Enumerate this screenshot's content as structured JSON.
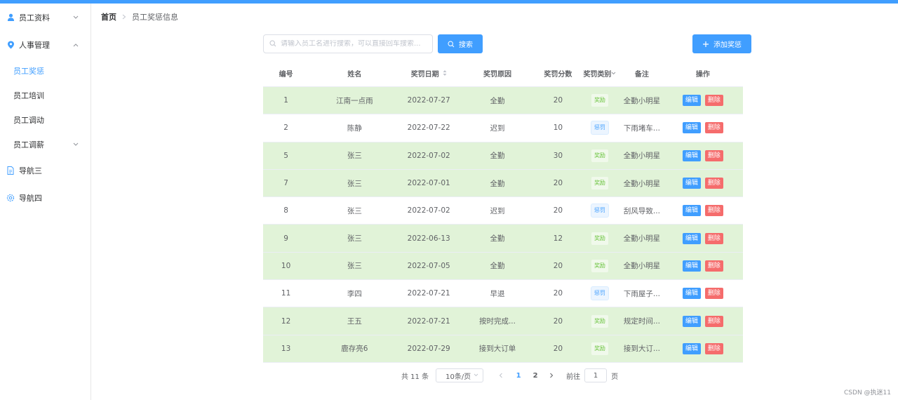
{
  "colors": {
    "primary": "#409eff",
    "success": "#67c23a",
    "danger": "#f56c6c",
    "row_highlight": "#e1f3d8"
  },
  "sidebar": {
    "groups": [
      {
        "label": "员工资料",
        "icon": "user-icon",
        "expanded": false
      },
      {
        "label": "人事管理",
        "icon": "location-icon",
        "expanded": true
      }
    ],
    "sub_items": [
      "员工奖惩",
      "员工培训",
      "员工调动",
      "员工调薪"
    ],
    "active_item": "员工奖惩",
    "extra": [
      {
        "label": "导航三",
        "icon": "document-icon"
      },
      {
        "label": "导航四",
        "icon": "setting-icon"
      }
    ]
  },
  "breadcrumb": {
    "home": "首页",
    "current": "员工奖惩信息"
  },
  "search": {
    "placeholder": "请输入员工名进行搜索，可以直接回车搜索...",
    "value": "",
    "button": "搜索"
  },
  "add_button": "添加奖惩",
  "table": {
    "headers": [
      "编号",
      "姓名",
      "奖罚日期",
      "奖罚原因",
      "奖罚分数",
      "奖罚类别",
      "备注",
      "操作"
    ],
    "edit_label": "编辑",
    "delete_label": "删除",
    "rows": [
      {
        "id": "1",
        "name": "江南一点雨",
        "date": "2022-07-27",
        "reason": "全勤",
        "score": "20",
        "type": "奖励",
        "kind": "reward",
        "remark": "全勤小明星"
      },
      {
        "id": "2",
        "name": "陈静",
        "date": "2022-07-22",
        "reason": "迟到",
        "score": "10",
        "type": "惩罚",
        "kind": "punish",
        "remark": "下雨堵车..."
      },
      {
        "id": "5",
        "name": "张三",
        "date": "2022-07-02",
        "reason": "全勤",
        "score": "30",
        "type": "奖励",
        "kind": "reward",
        "remark": "全勤小明星"
      },
      {
        "id": "7",
        "name": "张三",
        "date": "2022-07-01",
        "reason": "全勤",
        "score": "20",
        "type": "奖励",
        "kind": "reward",
        "remark": "全勤小明星"
      },
      {
        "id": "8",
        "name": "张三",
        "date": "2022-07-02",
        "reason": "迟到",
        "score": "20",
        "type": "惩罚",
        "kind": "punish",
        "remark": "刮风导致..."
      },
      {
        "id": "9",
        "name": "张三",
        "date": "2022-06-13",
        "reason": "全勤",
        "score": "12",
        "type": "奖励",
        "kind": "reward",
        "remark": "全勤小明星"
      },
      {
        "id": "10",
        "name": "张三",
        "date": "2022-07-05",
        "reason": "全勤",
        "score": "20",
        "type": "奖励",
        "kind": "reward",
        "remark": "全勤小明星"
      },
      {
        "id": "11",
        "name": "李四",
        "date": "2022-07-21",
        "reason": "早退",
        "score": "20",
        "type": "惩罚",
        "kind": "punish",
        "remark": "下雨屋子..."
      },
      {
        "id": "12",
        "name": "王五",
        "date": "2022-07-21",
        "reason": "按时完成...",
        "score": "20",
        "type": "奖励",
        "kind": "reward",
        "remark": "规定时间..."
      },
      {
        "id": "13",
        "name": "鹿存亮6",
        "date": "2022-07-29",
        "reason": "接到大订单",
        "score": "20",
        "type": "奖励",
        "kind": "reward",
        "remark": "接到大订..."
      }
    ]
  },
  "pagination": {
    "total_text": "共 11 条",
    "page_size": "10条/页",
    "pages": [
      "1",
      "2"
    ],
    "current_page": "1",
    "goto_label": "前往",
    "goto_value": "1",
    "page_unit": "页"
  },
  "watermark": "CSDN @执迷11"
}
